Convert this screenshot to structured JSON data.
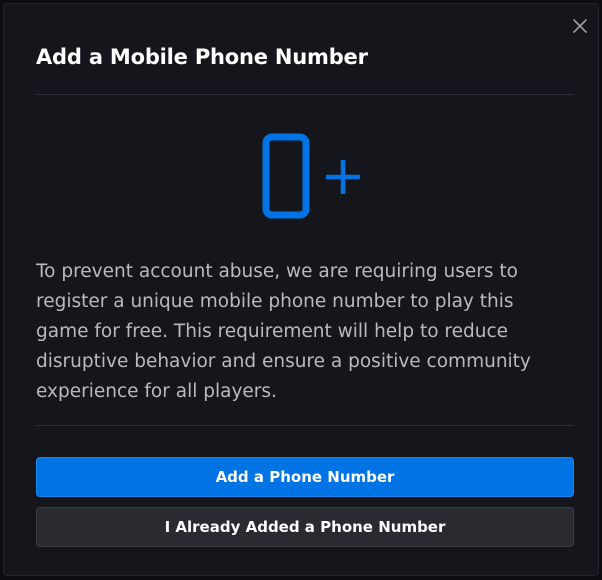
{
  "modal": {
    "title": "Add a Mobile Phone Number",
    "close_icon": "close-icon",
    "hero_icon": "add-mobile-phone-icon",
    "description": "To prevent account abuse, we are requiring users to register a unique mobile phone number to play this game for free. This requirement will help to reduce disruptive behavior and ensure a positive community experience for all players.",
    "primary_button_label": "Add a Phone Number",
    "secondary_button_label": "I Already Added a Phone Number"
  },
  "colors": {
    "accent": "#0074e4",
    "background": "#15161b",
    "secondary_button": "#2a2b30",
    "text_primary": "#ffffff",
    "text_secondary": "#b8bac0"
  }
}
